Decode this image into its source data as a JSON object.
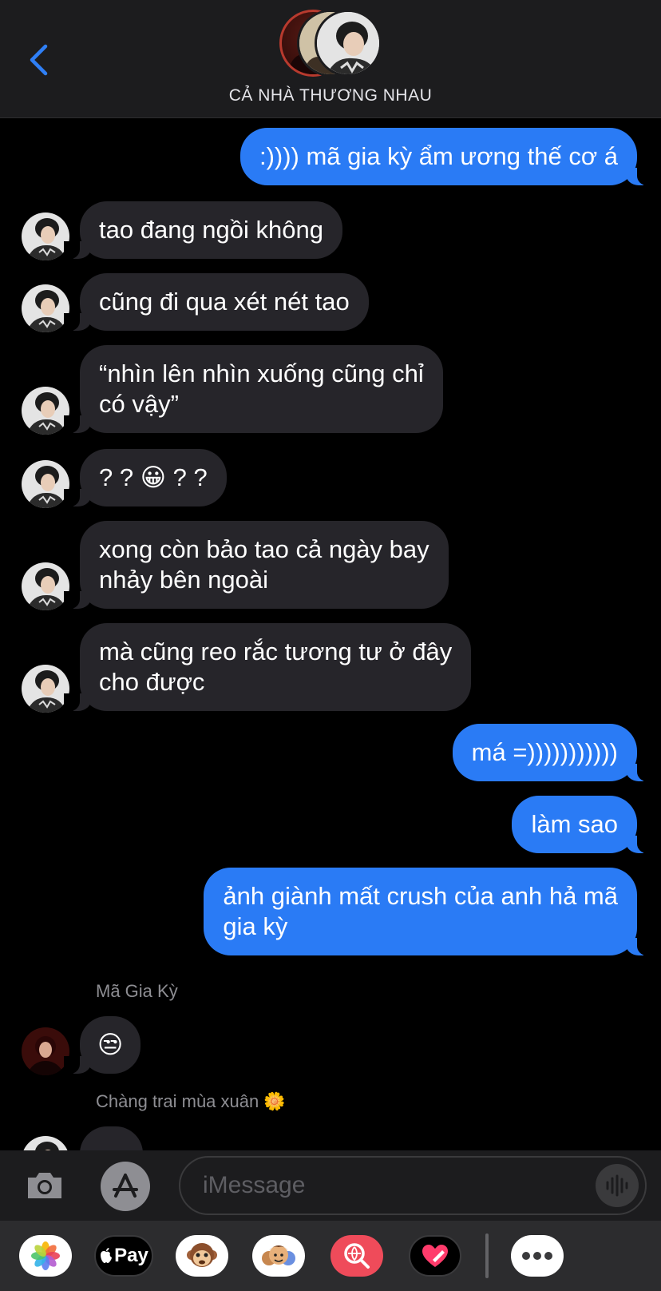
{
  "header": {
    "back_icon": "chevron-left-icon",
    "group_name": "CẢ NHÀ THƯƠNG NHAU"
  },
  "messages": [
    {
      "dir": "out",
      "text": ":)))) mã gia kỳ ẩm ương thế cơ á"
    },
    {
      "dir": "in",
      "text": "tao đang ngồi không"
    },
    {
      "dir": "in",
      "text": "cũng đi qua xét nét tao"
    },
    {
      "dir": "in",
      "text": "“nhìn lên nhìn xuống cũng chỉ\ncó vậy”"
    },
    {
      "dir": "in",
      "text": "? ? 😀 ? ?"
    },
    {
      "dir": "in",
      "text": "xong còn bảo tao cả ngày bay\nnhảy bên ngoài"
    },
    {
      "dir": "in",
      "text": "mà cũng reo rắc tương tư ở đây\ncho được"
    },
    {
      "dir": "out",
      "text": "má =)))))))))))"
    },
    {
      "dir": "out",
      "text": "làm sao"
    },
    {
      "dir": "out",
      "text": "ảnh giành mất crush của anh hả mã\ngia kỳ"
    },
    {
      "dir": "in",
      "sender": "Mã Gia Kỳ",
      "text": "😒"
    },
    {
      "dir": "in",
      "sender": "Chàng trai mùa xuân 🌼",
      "text": "…"
    }
  ],
  "input": {
    "placeholder": "iMessage",
    "camera_icon": "camera-icon",
    "apps_icon": "app-store-icon",
    "audio_icon": "waveform-icon"
  },
  "drawer": {
    "apps": [
      "photos-icon",
      "apple-pay-icon",
      "monkey-animoji-icon",
      "memoji-icon",
      "image-search-icon",
      "digital-touch-icon",
      "more-icon"
    ],
    "apple_pay_label": "Pay"
  },
  "colors": {
    "outgoing_bubble": "#2a7bf5",
    "incoming_bubble": "#26252a",
    "background": "#000000",
    "accent": "#2f7ff6"
  }
}
